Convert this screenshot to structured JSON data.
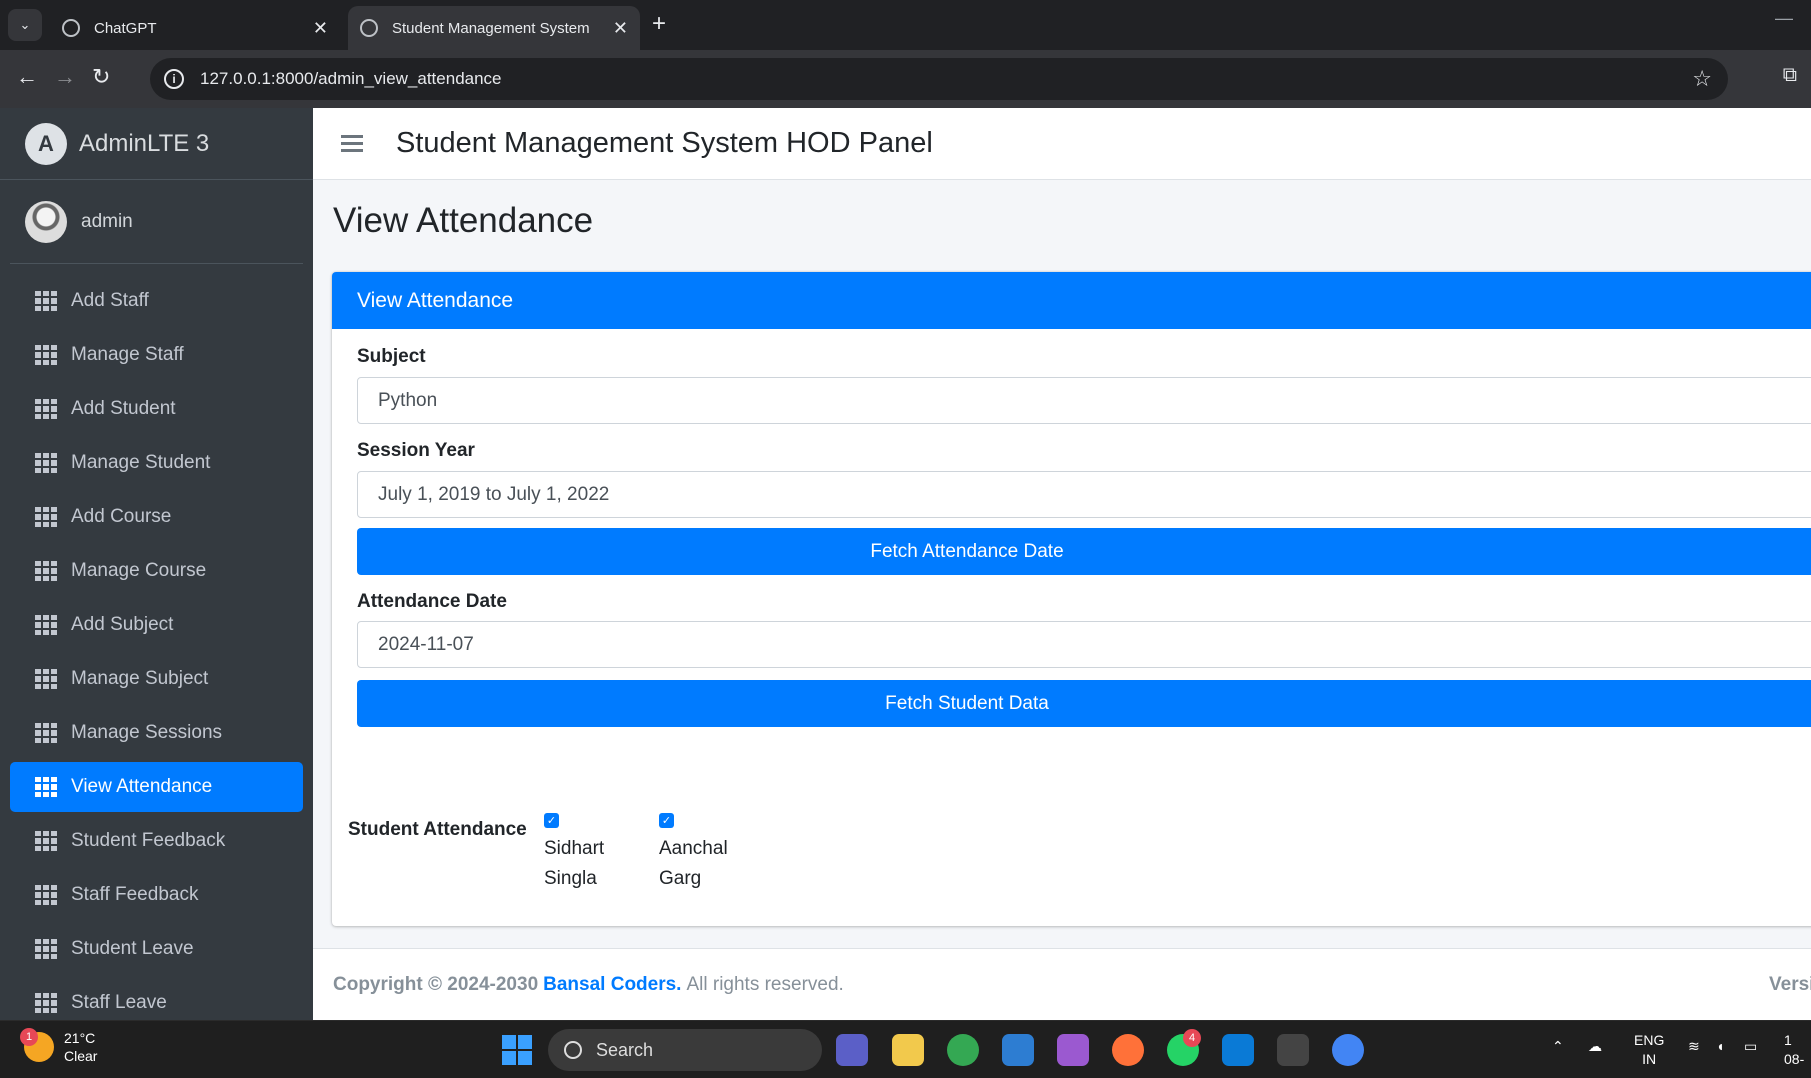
{
  "browser": {
    "tabs": [
      {
        "title": "ChatGPT",
        "active": false
      },
      {
        "title": "Student Management System",
        "active": true
      }
    ],
    "url": "127.0.0.1:8000/admin_view_attendance"
  },
  "sidebar": {
    "brand": "AdminLTE 3",
    "user": "admin",
    "items": [
      {
        "label": "Add Staff"
      },
      {
        "label": "Manage Staff"
      },
      {
        "label": "Add Student"
      },
      {
        "label": "Manage Student"
      },
      {
        "label": "Add Course"
      },
      {
        "label": "Manage Course"
      },
      {
        "label": "Add Subject"
      },
      {
        "label": "Manage Subject"
      },
      {
        "label": "Manage Sessions"
      },
      {
        "label": "View Attendance",
        "active": true
      },
      {
        "label": "Student Feedback"
      },
      {
        "label": "Staff Feedback"
      },
      {
        "label": "Student Leave"
      },
      {
        "label": "Staff Leave"
      }
    ]
  },
  "header": {
    "title": "Student Management System HOD Panel"
  },
  "page": {
    "title": "View Attendance",
    "card_title": "View Attendance",
    "subject_label": "Subject",
    "subject_value": "Python",
    "session_label": "Session Year",
    "session_value": "July 1, 2019 to July 1, 2022",
    "fetch_date_button": "Fetch Attendance Date",
    "date_label": "Attendance Date",
    "date_value": "2024-11-07",
    "fetch_student_button": "Fetch Student Data",
    "attendance_label": "Student Attendance",
    "students": [
      {
        "first": "Sidhart",
        "last": "Singla",
        "checked": true
      },
      {
        "first": "Aanchal",
        "last": "Garg",
        "checked": true
      }
    ]
  },
  "footer": {
    "copyright": "Copyright © 2024-2030",
    "company": "Bansal Coders.",
    "rights": "All rights reserved.",
    "version": "Versi"
  },
  "taskbar": {
    "weather_badge": "1",
    "temp": "21°C",
    "condition": "Clear",
    "search": "Search",
    "whatsapp_badge": "4",
    "lang": "ENG",
    "region": "IN",
    "clock_time": "1",
    "clock_date": "08-"
  },
  "colors": {
    "primary": "#007bff",
    "sidebar_bg": "#343a40",
    "content_bg": "#f4f6f9"
  }
}
